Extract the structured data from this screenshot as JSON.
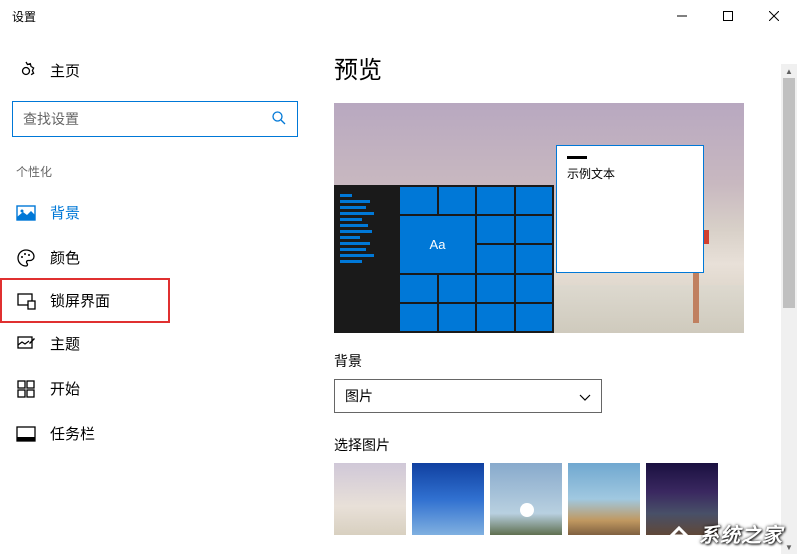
{
  "titlebar": {
    "title": "设置"
  },
  "sidebar": {
    "home_label": "主页",
    "search_placeholder": "查找设置",
    "category": "个性化",
    "items": [
      {
        "label": "背景"
      },
      {
        "label": "颜色"
      },
      {
        "label": "锁屏界面"
      },
      {
        "label": "主题"
      },
      {
        "label": "开始"
      },
      {
        "label": "任务栏"
      }
    ]
  },
  "main": {
    "preview_heading": "预览",
    "sample_text": "示例文本",
    "tile_text": "Aa",
    "background_label": "背景",
    "background_dropdown_value": "图片",
    "choose_picture_label": "选择图片"
  },
  "watermark": "系统之家"
}
